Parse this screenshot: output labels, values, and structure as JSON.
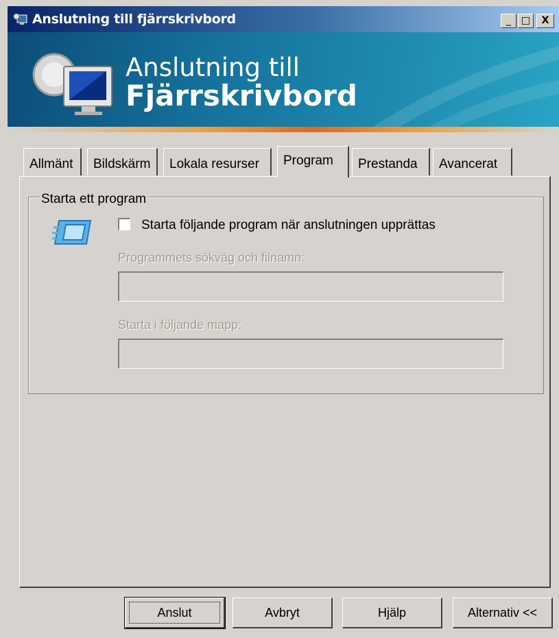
{
  "window": {
    "title": "Anslutning till fjärrskrivbord",
    "min_label": "_",
    "max_label": "□",
    "close_label": "X"
  },
  "banner": {
    "line1": "Anslutning till",
    "line2": "Fjärrskrivbord"
  },
  "tabs": [
    {
      "label": "Allmänt"
    },
    {
      "label": "Bildskärm"
    },
    {
      "label": "Lokala resurser"
    },
    {
      "label": "Program",
      "active": true
    },
    {
      "label": "Prestanda"
    },
    {
      "label": "Avancerat"
    }
  ],
  "group": {
    "label": "Starta ett program",
    "checkbox_label": "Starta följande program när anslutningen upprättas",
    "checkbox_checked": false,
    "path_label": "Programmets sökväg och filnamn:",
    "path_value": "",
    "folder_label": "Starta i följande mapp:",
    "folder_value": ""
  },
  "buttons": {
    "connect": "Anslut",
    "cancel": "Avbryt",
    "help": "Hjälp",
    "options": "Alternativ <<"
  },
  "colors": {
    "dialog_bg": "#d6d3ce",
    "title_bar_start": "#0a246a",
    "banner": "#14709a",
    "banner_stripe": "#e06820",
    "disabled_text": "#a09c94"
  }
}
